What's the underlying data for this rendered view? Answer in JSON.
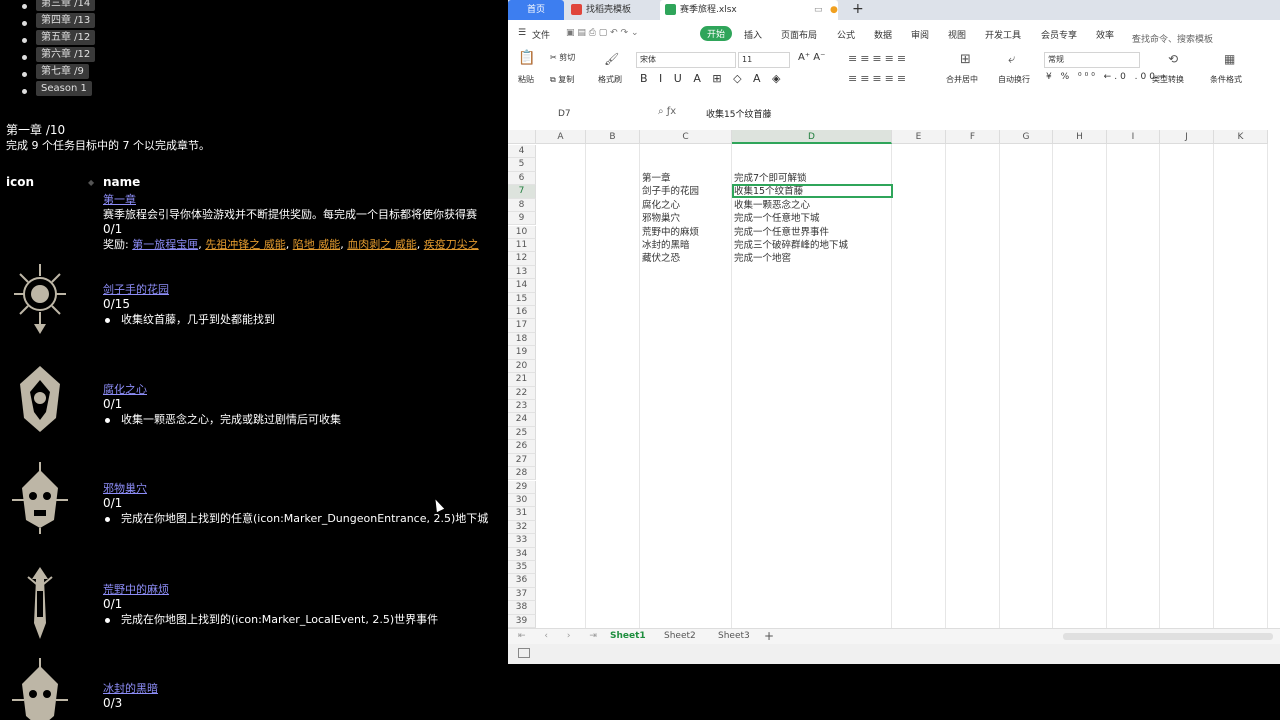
{
  "left": {
    "chapters": [
      "第三章 /14",
      "第四章 /13",
      "第五章 /12",
      "第六章 /12",
      "第七章 /9",
      "Season 1"
    ],
    "chapter_title": "第一章 /10",
    "chapter_desc": "完成 9 个任务目标中的 7 个以完成章节。",
    "col_icon": "icon",
    "col_name": "name",
    "intro": {
      "name": "第一章",
      "desc": "赛季旅程会引导你体验游戏并不断提供奖励。每完成一个目标都将使你获得赛",
      "progress": "0/1",
      "reward_label": "奖励: ",
      "rewards": [
        "第一旅程宝匣",
        "先祖冲锋之 威能",
        "陷地 威能",
        "血肉剥之 威能",
        "疾疫刀尖之"
      ]
    },
    "quests": [
      {
        "name": "剑子手的花园",
        "progress": "0/15",
        "bullet": "收集纹首藤，几乎到处都能找到"
      },
      {
        "name": "腐化之心",
        "progress": "0/1",
        "bullet": "收集一颗恶念之心，完成或跳过剧情后可收集"
      },
      {
        "name": "邪物巢穴",
        "progress": "0/1",
        "bullet": "完成在你地图上找到的任意(icon:Marker_DungeonEntrance, 2.5)地下城"
      },
      {
        "name": "荒野中的麻烦",
        "progress": "0/1",
        "bullet": "完成在你地图上找到的(icon:Marker_LocalEvent, 2.5)世界事件"
      },
      {
        "name": "冰封的黑暗",
        "progress": "0/3",
        "bullet": ""
      }
    ]
  },
  "excel": {
    "tabs": {
      "home": "首页",
      "template": "找稻壳模板",
      "file": "赛季旅程.xlsx"
    },
    "menu": [
      "文件",
      "开始",
      "插入",
      "页面布局",
      "公式",
      "数据",
      "审阅",
      "视图",
      "开发工具",
      "会员专享",
      "效率"
    ],
    "search_placeholder": "查找命令、搜索模板",
    "ribbon": {
      "cut": "剪切",
      "copy": "复制",
      "paste": "粘贴",
      "format_painter": "格式刷",
      "font": "宋体",
      "font_size": "11",
      "merge": "合并居中",
      "wrap": "自动换行",
      "number_format": "常规",
      "type_convert": "类型转换",
      "cond_format": "条件格式"
    },
    "name_box": "D7",
    "formula": "收集15个纹首藤",
    "columns": [
      "A",
      "B",
      "C",
      "D",
      "E",
      "F",
      "G",
      "H",
      "I",
      "J",
      "K"
    ],
    "rows": [
      4,
      5,
      6,
      7,
      8,
      9,
      10,
      11,
      12,
      13,
      14,
      15,
      16,
      17,
      18,
      19,
      20,
      21,
      22,
      23,
      24,
      25,
      26,
      27,
      28,
      29,
      30,
      31,
      32,
      33,
      34,
      35,
      36,
      37,
      38,
      39
    ],
    "selected_row": 7,
    "selected_col": "D",
    "cells": [
      {
        "row": 6,
        "c": "第一章",
        "d": "完成7个即可解锁"
      },
      {
        "row": 7,
        "c": "剑子手的花园",
        "d": "收集15个纹首藤"
      },
      {
        "row": 8,
        "c": "腐化之心",
        "d": "收集一颗恶念之心"
      },
      {
        "row": 9,
        "c": "邪物巢穴",
        "d": "完成一个任意地下城"
      },
      {
        "row": 10,
        "c": "荒野中的麻烦",
        "d": "完成一个任意世界事件"
      },
      {
        "row": 11,
        "c": "冰封的黑暗",
        "d": "完成三个破碎群峰的地下城"
      },
      {
        "row": 12,
        "c": "藏伏之恐",
        "d": "完成一个地窖"
      }
    ],
    "sheets": [
      "Sheet1",
      "Sheet2",
      "Sheet3"
    ]
  }
}
